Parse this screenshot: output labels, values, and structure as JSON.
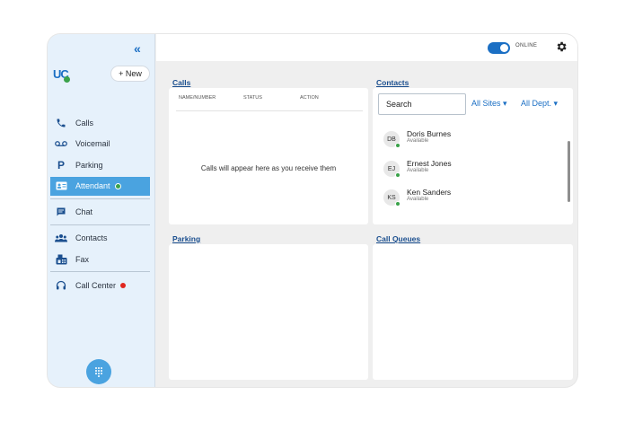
{
  "sidebar": {
    "collapse_icon": "double-chevron-left-icon",
    "logo": "UC",
    "new_button": "+ New",
    "items": [
      {
        "label": "Calls",
        "icon": "phone-icon"
      },
      {
        "label": "Voicemail",
        "icon": "voicemail-icon"
      },
      {
        "label": "Parking",
        "icon": "parking-icon"
      },
      {
        "label": "Attendant",
        "icon": "attendant-icon",
        "active": true,
        "status_color": "#3aa24a"
      },
      {
        "label": "Chat",
        "icon": "chat-icon"
      },
      {
        "label": "Contacts",
        "icon": "contacts-icon"
      },
      {
        "label": "Fax",
        "icon": "fax-icon"
      },
      {
        "label": "Call Center",
        "icon": "headset-icon",
        "status_color": "#e0261f"
      }
    ],
    "dialpad_icon": "dialpad-icon"
  },
  "topbar": {
    "status_label": "ONLINE",
    "settings_icon": "gear-icon"
  },
  "calls": {
    "title": "Calls",
    "columns": [
      "NAME/NUMBER",
      "STATUS",
      "ACTION"
    ],
    "empty_message": "Calls will appear here as you receive them"
  },
  "contacts": {
    "title": "Contacts",
    "search_placeholder": "Search",
    "filter_sites": "All Sites ▾",
    "filter_dept": "All Dept. ▾",
    "list": [
      {
        "initials": "DB",
        "name": "Doris Burnes",
        "status": "Available"
      },
      {
        "initials": "EJ",
        "name": "Ernest Jones",
        "status": "Available"
      },
      {
        "initials": "KS",
        "name": "Ken Sanders",
        "status": "Available"
      }
    ]
  },
  "parking": {
    "title": "Parking"
  },
  "call_queues": {
    "title": "Call Queues"
  },
  "colors": {
    "accent": "#1b6fc4",
    "active_nav": "#4aa3e0",
    "available": "#3aa24a",
    "busy": "#e0261f"
  }
}
